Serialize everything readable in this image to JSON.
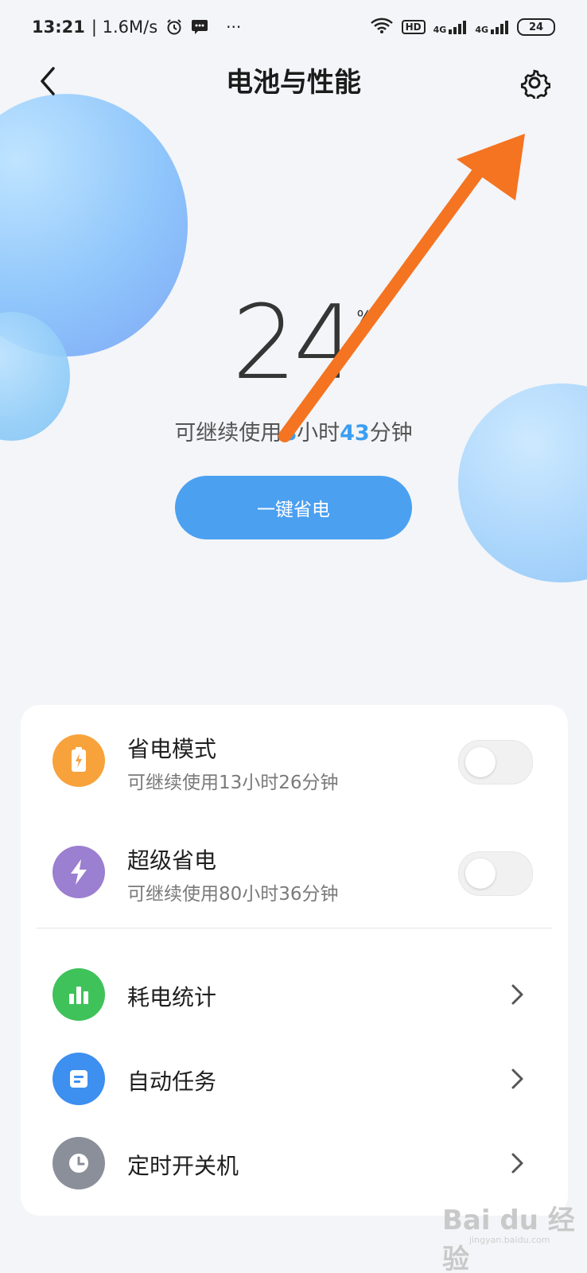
{
  "status_bar": {
    "time": "13:21",
    "speed": "| 1.6M/s",
    "more": "···",
    "net_a": "4G",
    "net_b": "4G",
    "hd": "HD",
    "battery": "24"
  },
  "header": {
    "title": "电池与性能"
  },
  "battery": {
    "percent": "24",
    "percent_sign": "%",
    "remain_prefix": "可继续使用",
    "remain_hours": "8",
    "remain_hours_unit": "小时",
    "remain_minutes": "43",
    "remain_minutes_unit": "分钟",
    "save_button": "一键省电"
  },
  "modes": [
    {
      "label": "省电模式",
      "sub": "可继续使用13小时26分钟",
      "enabled": false,
      "icon": "battery-bolt-icon",
      "color": "#f7a23b"
    },
    {
      "label": "超级省电",
      "sub": "可继续使用80小时36分钟",
      "enabled": false,
      "icon": "bolt-icon",
      "color": "#9b7fd0"
    }
  ],
  "menu": [
    {
      "label": "耗电统计",
      "icon": "bar-chart-icon",
      "color": "#3fc25a"
    },
    {
      "label": "自动任务",
      "icon": "task-list-icon",
      "color": "#3d8ff0"
    },
    {
      "label": "定时开关机",
      "icon": "clock-icon",
      "color": "#8a8f99"
    }
  ],
  "annotation_color": "#f47421",
  "watermark": {
    "brand": "Bai du 经验",
    "url": "jingyan.baidu.com"
  }
}
